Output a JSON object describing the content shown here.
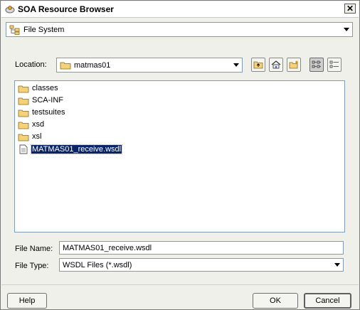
{
  "window": {
    "title": "SOA Resource Browser",
    "close_glyph": "✕"
  },
  "source_combo": {
    "value": "File System",
    "icon": "file-system-icon"
  },
  "location": {
    "label": "Location:",
    "value": "matmas01",
    "icon": "folder-icon"
  },
  "toolbar": {
    "icons": [
      "up-folder-icon",
      "home-icon",
      "new-folder-icon",
      "list-view-icon",
      "details-view-icon"
    ]
  },
  "files": [
    {
      "name": "classes",
      "type": "folder"
    },
    {
      "name": "SCA-INF",
      "type": "folder"
    },
    {
      "name": "testsuites",
      "type": "folder"
    },
    {
      "name": "xsd",
      "type": "folder"
    },
    {
      "name": "xsl",
      "type": "folder"
    },
    {
      "name": "MATMAS01_receive.wsdl",
      "type": "file",
      "selected": true
    }
  ],
  "file_name": {
    "label": "File Name:",
    "value": "MATMAS01_receive.wsdl"
  },
  "file_type": {
    "label": "File Type:",
    "value": "WSDL Files (*.wsdl)"
  },
  "buttons": {
    "help": "Help",
    "ok": "OK",
    "cancel": "Cancel"
  },
  "colors": {
    "selection": "#0a246a",
    "folder": "#f3d27a",
    "dialog_bg": "#f0f0ea"
  }
}
